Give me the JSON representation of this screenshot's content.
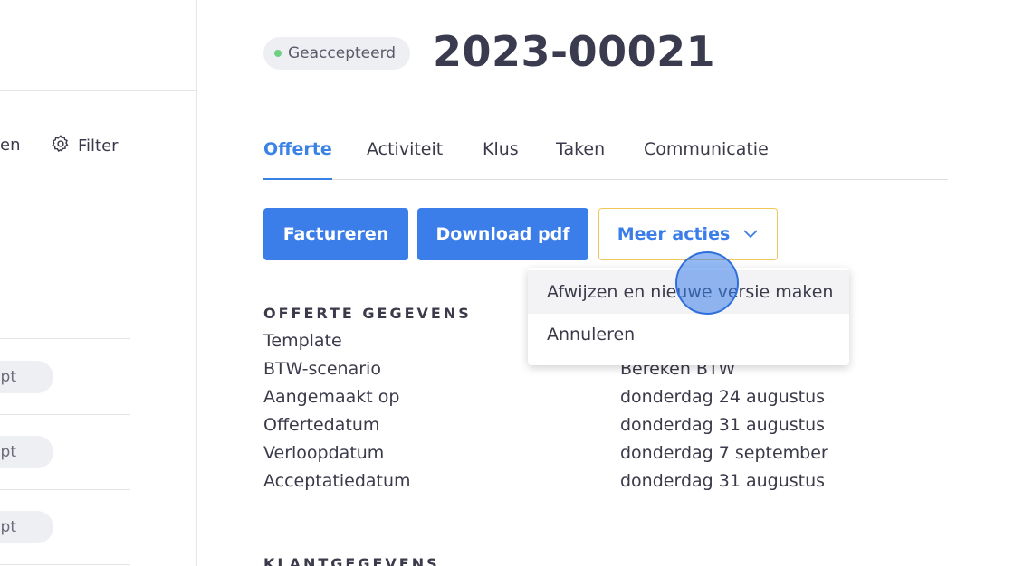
{
  "sidebar": {
    "partial_label": "en",
    "filter_label": "Filter",
    "rows": [
      {
        "badge": "pt"
      },
      {
        "badge": "pt"
      },
      {
        "badge": "pt"
      }
    ]
  },
  "header": {
    "status": "Geaccepteerd",
    "status_color": "#6fcf83",
    "title": "2023-00021"
  },
  "tabs": [
    {
      "label": "Offerte",
      "active": true
    },
    {
      "label": "Activiteit"
    },
    {
      "label": "Klus"
    },
    {
      "label": "Taken"
    },
    {
      "label": "Communicatie"
    }
  ],
  "actions": {
    "invoice_label": "Factureren",
    "download_label": "Download pdf",
    "more_label": "Meer acties",
    "menu": [
      {
        "label": "Afwijzen en nieuwe versie maken"
      },
      {
        "label": "Annuleren"
      }
    ]
  },
  "details": {
    "heading": "OFFERTE GEGEVENS",
    "rows": [
      {
        "label": "Template",
        "value": ""
      },
      {
        "label": "BTW-scenario",
        "value": "Bereken BTW"
      },
      {
        "label": "Aangemaakt op",
        "value": "donderdag 24 augustus"
      },
      {
        "label": "Offertedatum",
        "value": "donderdag 31 augustus"
      },
      {
        "label": "Verloopdatum",
        "value": "donderdag 7 september"
      },
      {
        "label": "Acceptatiedatum",
        "value": "donderdag 31 augustus"
      }
    ]
  },
  "customer": {
    "heading": "KLANTGEGEVENS"
  },
  "colors": {
    "accent": "#3b7de9",
    "outline": "#f0c85a"
  }
}
